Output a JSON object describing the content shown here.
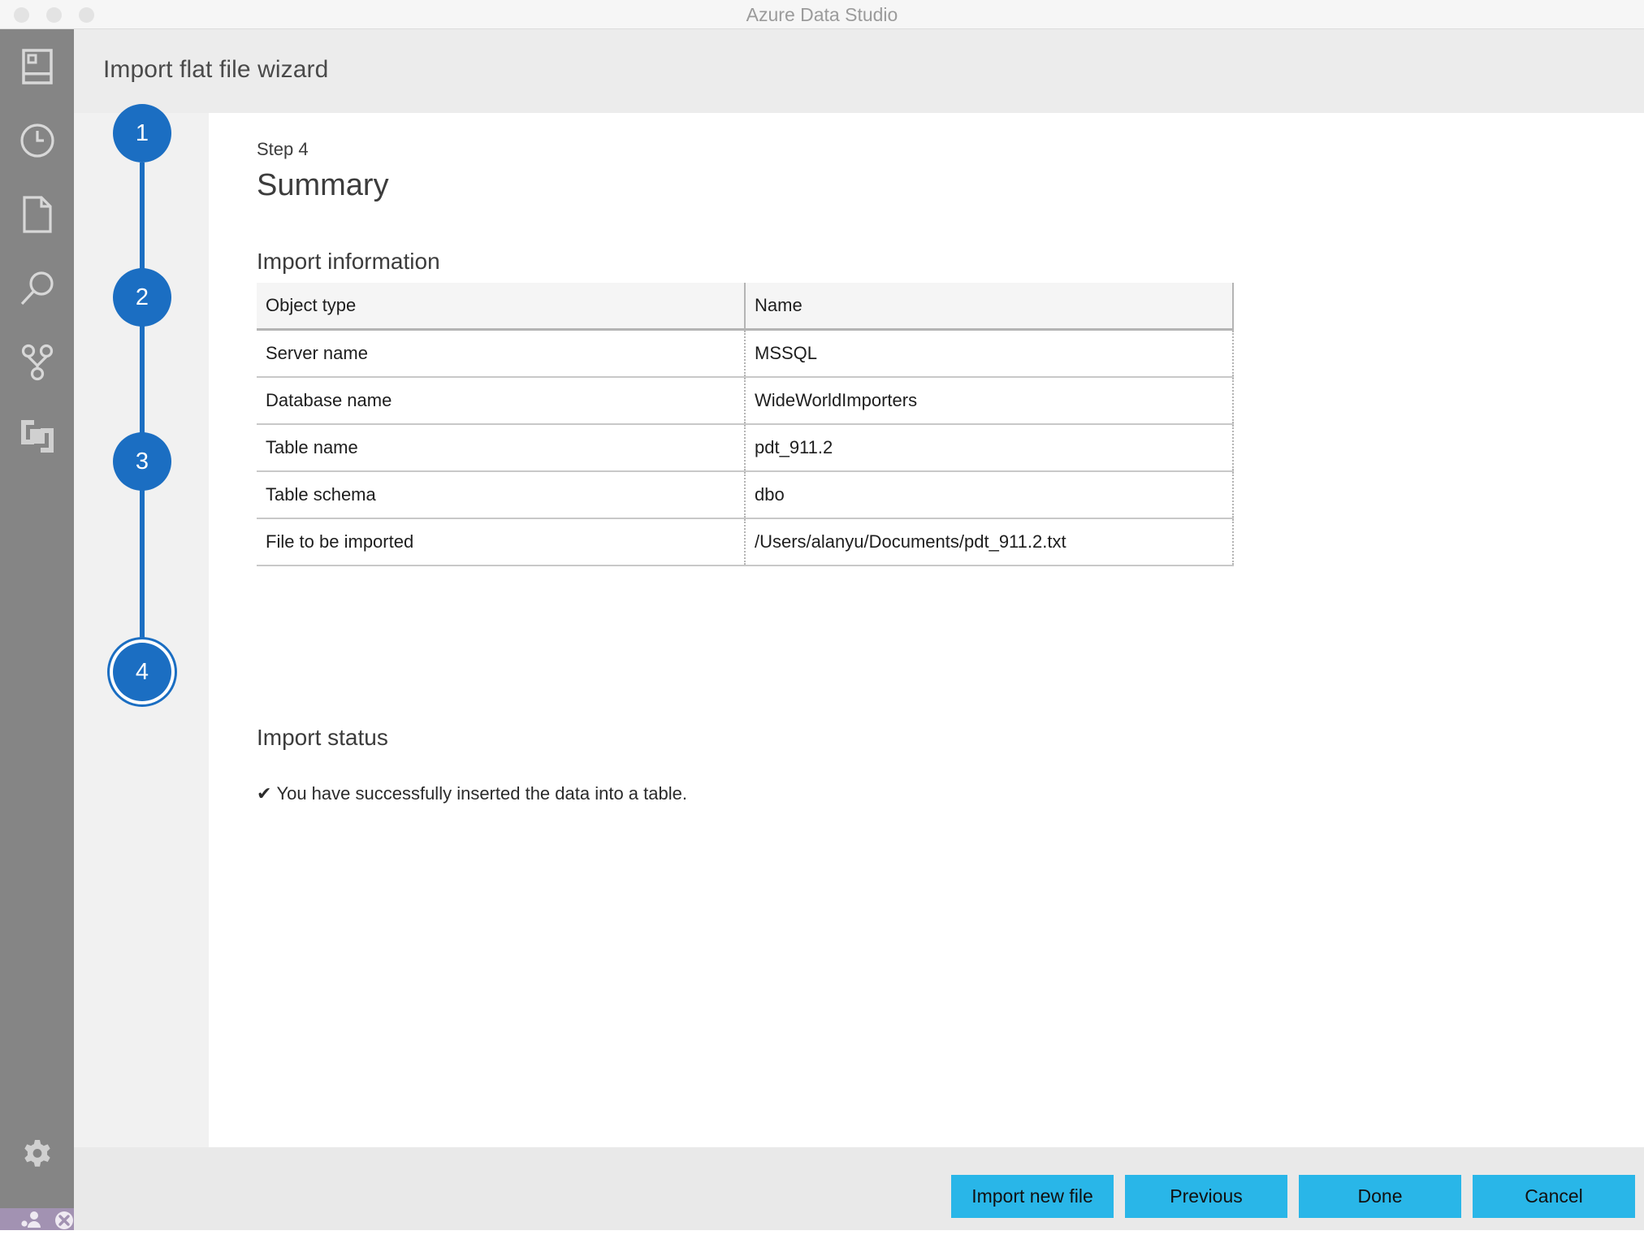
{
  "window": {
    "title": "Azure Data Studio",
    "traffic_lights": [
      "close",
      "minimize",
      "maximize"
    ]
  },
  "activity_bar": {
    "items": [
      {
        "icon": "servers-icon",
        "label": "Servers"
      },
      {
        "icon": "history-clock-icon",
        "label": "History"
      },
      {
        "icon": "notebook-file-icon",
        "label": "Notebooks"
      },
      {
        "icon": "search-icon",
        "label": "Search"
      },
      {
        "icon": "source-control-icon",
        "label": "Source Control"
      },
      {
        "icon": "extensions-icon",
        "label": "Extensions"
      }
    ],
    "bottom_items": [
      {
        "icon": "gear-icon",
        "label": "Manage"
      }
    ]
  },
  "status_bar": {
    "items": [
      {
        "icon": "accounts-icon",
        "label": "Accounts"
      },
      {
        "icon": "error-circle-icon",
        "label": "Errors"
      }
    ],
    "background": "#a292b2"
  },
  "wizard": {
    "title": "Import flat file wizard",
    "accent_blue": "#1b6ec2",
    "button_cyan": "#29b6e8",
    "steps": [
      {
        "number": "1",
        "state": "complete"
      },
      {
        "number": "2",
        "state": "complete"
      },
      {
        "number": "3",
        "state": "complete"
      },
      {
        "number": "4",
        "state": "current-focused"
      }
    ]
  },
  "page": {
    "step_label": "Step 4",
    "heading": "Summary",
    "import_information": {
      "section_title": "Import information",
      "columns": [
        "Object type",
        "Name"
      ],
      "rows": [
        [
          "Server name",
          "MSSQL"
        ],
        [
          "Database name",
          "WideWorldImporters"
        ],
        [
          "Table name",
          "pdt_911.2"
        ],
        [
          "Table schema",
          "dbo"
        ],
        [
          "File to be imported",
          "/Users/alanyu/Documents/pdt_911.2.txt"
        ]
      ]
    },
    "import_status": {
      "section_title": "Import status",
      "check_glyph": "✔",
      "message": "You have successfully inserted the data into a table."
    }
  },
  "footer": {
    "buttons": [
      {
        "label": "Import new file"
      },
      {
        "label": "Previous"
      },
      {
        "label": "Done"
      },
      {
        "label": "Cancel"
      }
    ]
  }
}
